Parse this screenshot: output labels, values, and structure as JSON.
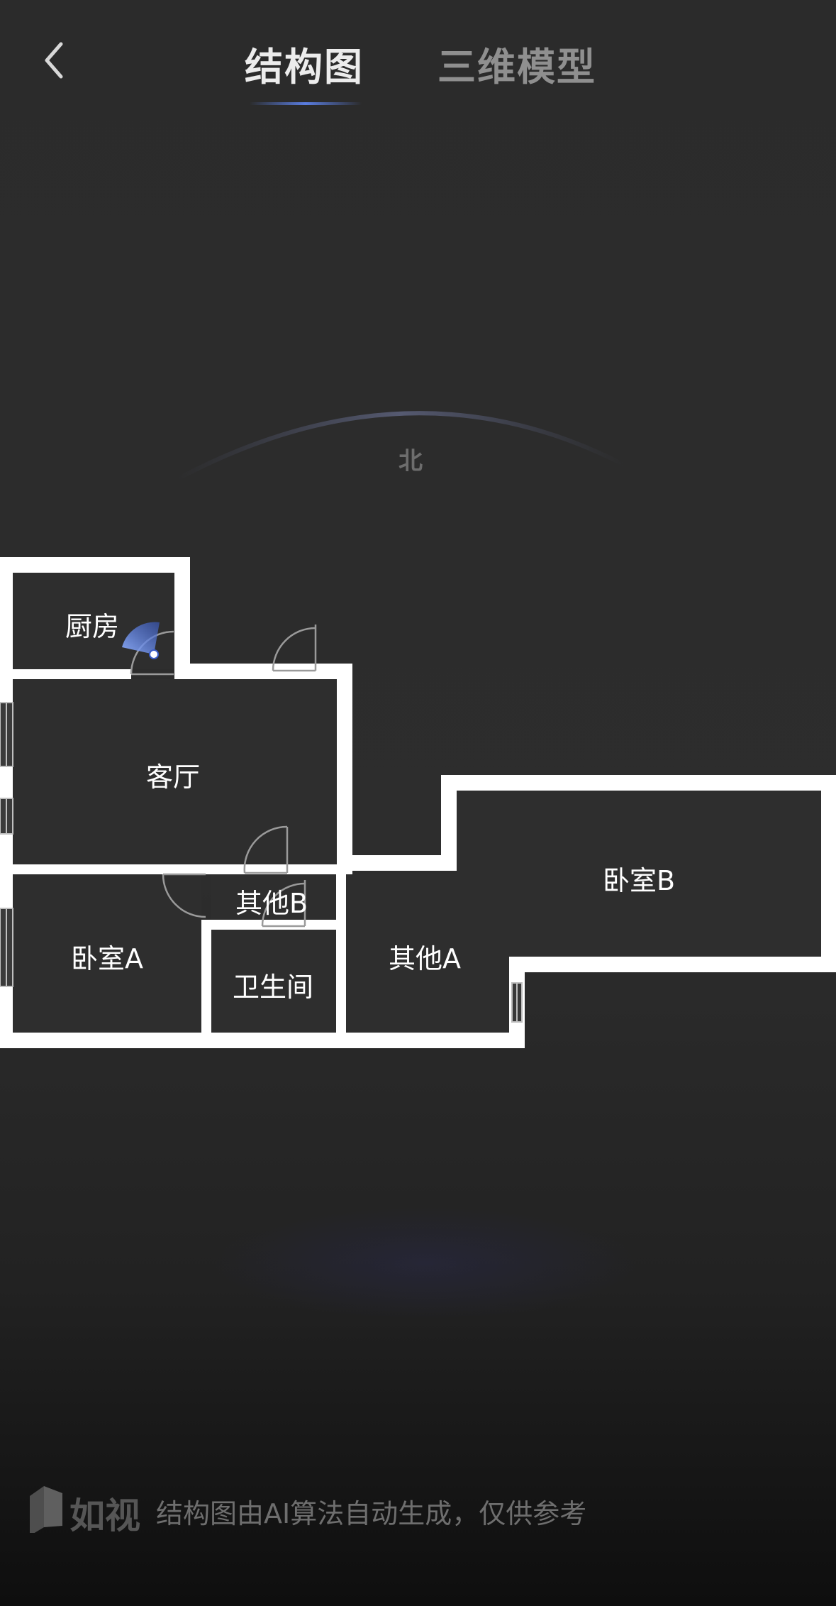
{
  "header": {
    "tabs": [
      {
        "label": "结构图",
        "active": true
      },
      {
        "label": "三维模型",
        "active": false
      }
    ]
  },
  "compass": {
    "direction_label": "北"
  },
  "floorplan": {
    "rooms": [
      {
        "name": "厨房"
      },
      {
        "name": "客厅"
      },
      {
        "name": "其他B"
      },
      {
        "name": "卧室A"
      },
      {
        "name": "卫生间"
      },
      {
        "name": "其他A"
      },
      {
        "name": "卧室B"
      }
    ]
  },
  "footer": {
    "brand": "如视",
    "disclaimer": "结构图由AI算法自动生成，仅供参考"
  },
  "colors": {
    "accent": "#5a7de0",
    "wall": "#ffffff",
    "floor": "#2e2e2e",
    "background": "#2b2b2b"
  }
}
